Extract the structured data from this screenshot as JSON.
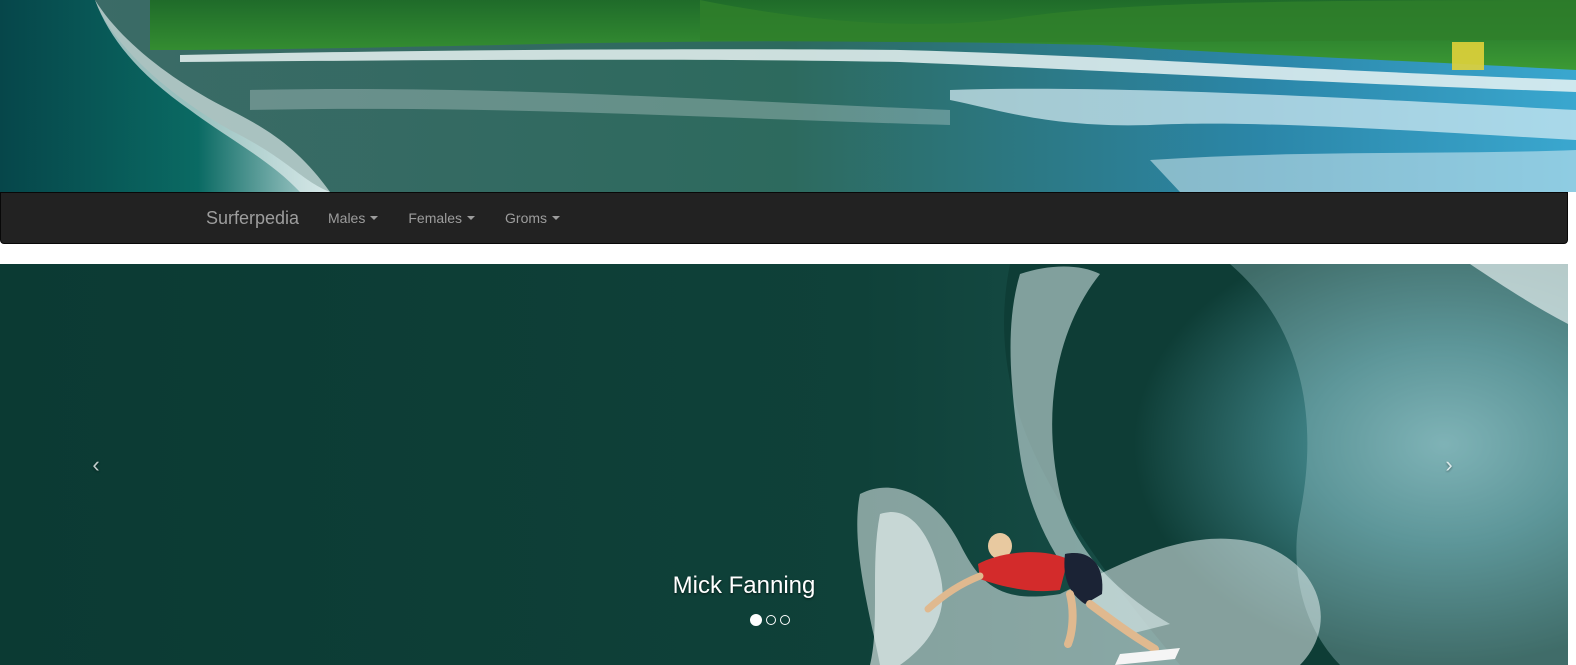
{
  "navbar": {
    "brand": "Surferpedia",
    "items": [
      {
        "label": "Males"
      },
      {
        "label": "Females"
      },
      {
        "label": "Groms"
      }
    ]
  },
  "carousel": {
    "prev_icon": "‹",
    "next_icon": "›",
    "caption": "Mick Fanning",
    "slide_count": 3,
    "active_slide": 1
  },
  "colors": {
    "navbar_bg": "#222222",
    "nav_text": "#9d9d9d",
    "ocean_dark": "#0e3d36"
  }
}
